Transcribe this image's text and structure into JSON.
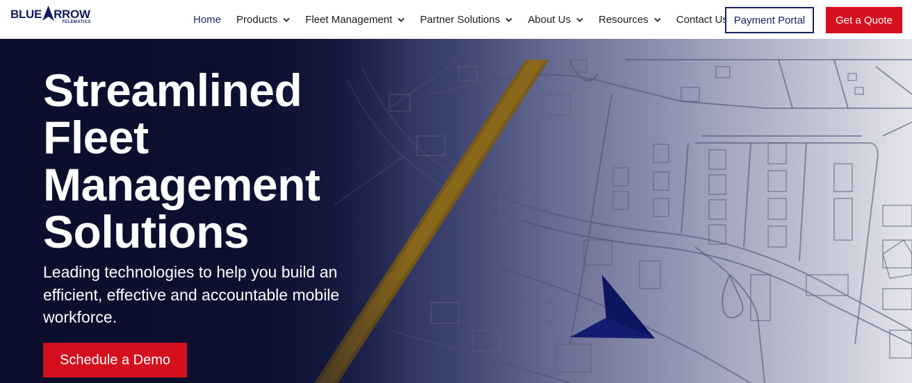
{
  "brand": {
    "name_left": "BLUE",
    "name_right": "RROW",
    "tagline": "TELEMATICS",
    "color": "#131a5c"
  },
  "nav": {
    "items": [
      {
        "label": "Home",
        "has_dropdown": false,
        "active": true
      },
      {
        "label": "Products",
        "has_dropdown": true
      },
      {
        "label": "Fleet Management",
        "has_dropdown": true
      },
      {
        "label": "Partner Solutions",
        "has_dropdown": true
      },
      {
        "label": "About Us",
        "has_dropdown": true
      },
      {
        "label": "Resources",
        "has_dropdown": true
      },
      {
        "label": "Contact Us",
        "has_dropdown": false
      }
    ],
    "payment_portal_label": "Payment Portal",
    "get_quote_label": "Get a Quote"
  },
  "hero": {
    "title_lines": [
      "Streamlined",
      "Fleet",
      "Management",
      "Solutions"
    ],
    "subtitle": "Leading technologies to help you build an efficient, effective and accountable mobile workforce.",
    "cta_label": "Schedule a Demo"
  },
  "colors": {
    "accent_red": "#d7101f",
    "brand_navy": "#18215f",
    "hero_dark": "#0d1131"
  },
  "icons": [
    "blue-arrow-logo-icon",
    "chevron-down-icon",
    "navigation-arrow-icon"
  ]
}
